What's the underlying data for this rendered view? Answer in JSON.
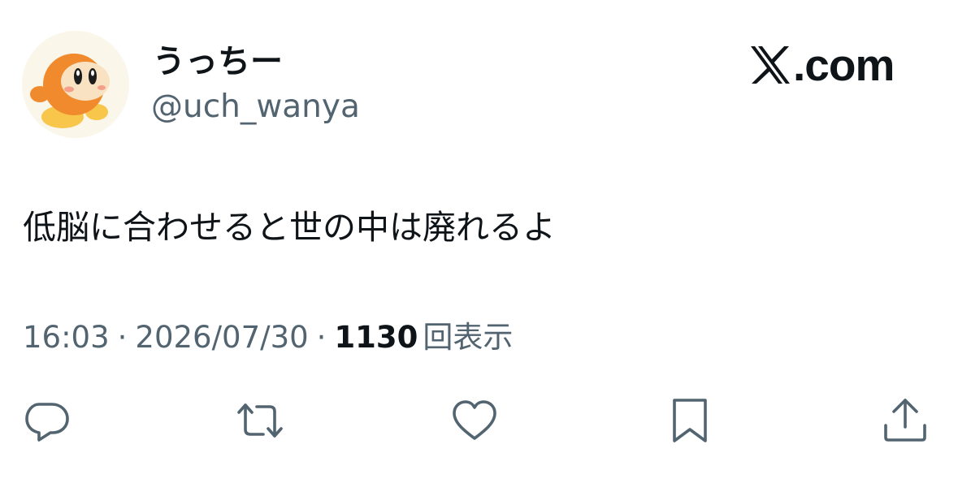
{
  "author": {
    "display_name": "うっちー",
    "handle": "@uch_wanya",
    "avatar_icon": "waddle-dee-avatar"
  },
  "brand": {
    "domain": ".com",
    "logo_icon": "x-logo-icon"
  },
  "tweet": {
    "text": "低脳に合わせると世の中は廃れるよ",
    "time": "16:03",
    "date": "2026/07/30",
    "separator": "·",
    "views_count": "1130",
    "views_label": "回表示"
  },
  "actions": [
    {
      "name": "reply",
      "icon": "reply-icon"
    },
    {
      "name": "repost",
      "icon": "repost-icon"
    },
    {
      "name": "like",
      "icon": "heart-icon"
    },
    {
      "name": "bookmark",
      "icon": "bookmark-icon"
    },
    {
      "name": "share",
      "icon": "share-icon"
    }
  ],
  "colors": {
    "text_primary": "#0f1419",
    "text_secondary": "#536471",
    "background": "#ffffff",
    "avatar_orange": "#f08a2c"
  }
}
